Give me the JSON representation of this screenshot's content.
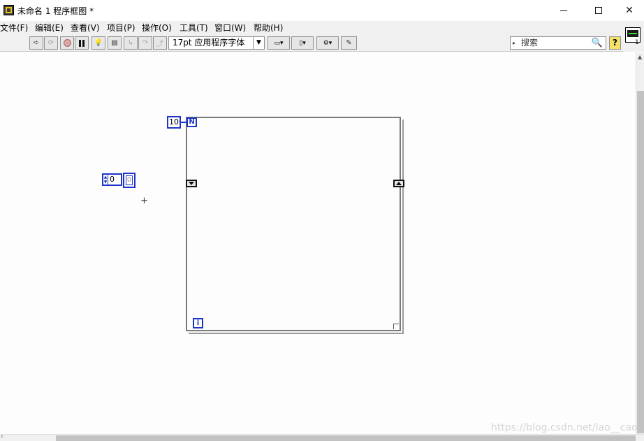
{
  "window": {
    "title": "未命名 1 程序框图 *",
    "minimize_icon": "minimize-icon",
    "maximize_icon": "maximize-icon",
    "close_glyph": "✕"
  },
  "menubar": {
    "items": [
      "文件(F)",
      "编辑(E)",
      "查看(V)",
      "项目(P)",
      "操作(O)",
      "工具(T)",
      "窗口(W)",
      "帮助(H)"
    ]
  },
  "toolbar": {
    "font_select": "17pt 应用程序字体",
    "search_placeholder": "搜索",
    "help_label": "?"
  },
  "vi_icon": {
    "connector_count": "1"
  },
  "diagram": {
    "loop_count_constant": "10",
    "count_terminal_label": "N",
    "iteration_terminal_label": "i",
    "numeric_control_value": "0",
    "numeric_indicator_value": "0"
  },
  "watermark": "https://blog.csdn.net/lao__cao",
  "colors": {
    "wire_blue": "#1e35c8",
    "loop_border": "#7a7a7a",
    "menubar_bg": "#f0f0f0"
  }
}
